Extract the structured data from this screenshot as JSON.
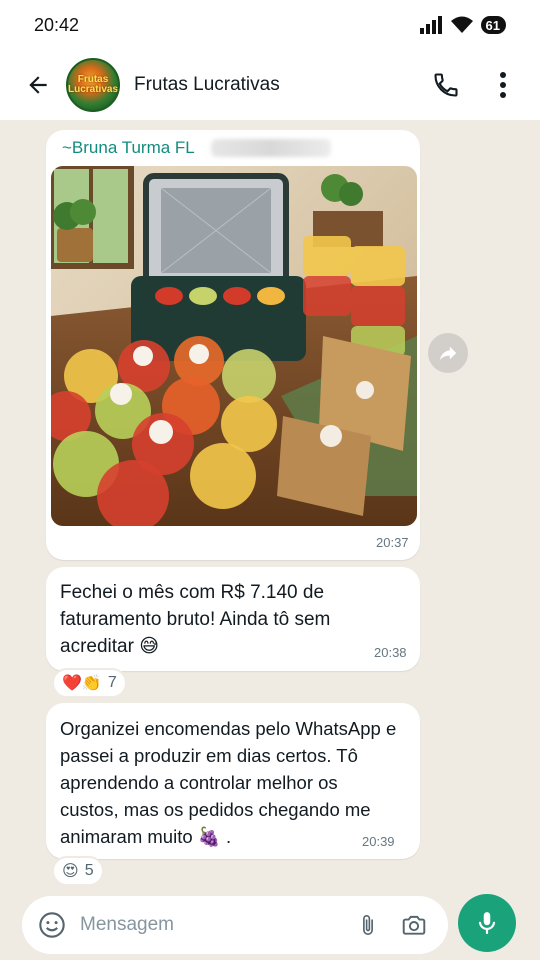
{
  "status_bar": {
    "time": "20:42",
    "battery": "61"
  },
  "header": {
    "title": "Frutas Lucrativas",
    "avatar_text": "Frutas Lucrativas"
  },
  "messages": [
    {
      "sender": "~Bruna Turma FL",
      "type": "image",
      "time": "20:37"
    },
    {
      "type": "text",
      "text": "Fechei o mês com R$ 7.140 de faturamento bruto! Ainda tô sem acreditar 😅",
      "time": "20:38",
      "reaction": {
        "emojis": "❤️👏",
        "count": "7"
      }
    },
    {
      "type": "text",
      "text": "Organizei encomendas pelo WhatsApp e passei a produzir em dias certos. Tô aprendendo a controlar melhor os custos, mas os pedidos chegando me animaram muito 🍇 .",
      "time": "20:39",
      "reaction": {
        "emojis": "😍",
        "count": "5"
      }
    }
  ],
  "composer": {
    "placeholder": "Mensagem"
  },
  "colors": {
    "accent": "#1aa37a",
    "sender": "#128c7e",
    "chat_bg": "#efeae2"
  },
  "icons": [
    "back-arrow-icon",
    "phone-icon",
    "more-vert-icon",
    "forward-icon",
    "emoji-icon",
    "attach-icon",
    "camera-icon",
    "mic-icon"
  ]
}
